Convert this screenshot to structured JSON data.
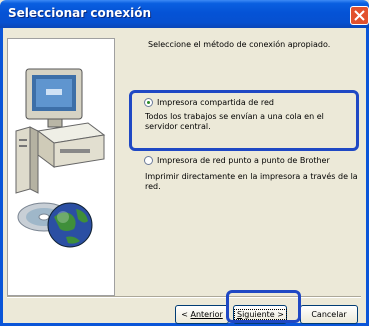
{
  "window": {
    "title": "Seleccionar conexión"
  },
  "main": {
    "instruction": "Seleccione el método de conexión apropiado.",
    "options": [
      {
        "label": "Impresora compartida de red",
        "description": "Todos los trabajos se envían a una cola en el servidor central.",
        "selected": true
      },
      {
        "label": "Impresora de red punto a punto de Brother",
        "description": "Imprimir directamente en la impresora a través de la red.",
        "selected": false
      }
    ]
  },
  "buttons": {
    "back_rest": "Anterior",
    "back_prefix": "< ",
    "next_mnemonic": "S",
    "next_rest": "iguiente >",
    "cancel": "Cancelar"
  },
  "icons": {
    "close": "close-icon",
    "illustration": "computer-cd-globe-illustration",
    "radio_on": "radio-selected-icon",
    "radio_off": "radio-unselected-icon"
  },
  "colors": {
    "titlebar": "#0553d6",
    "highlight": "#1f48c4",
    "dialog_bg": "#ece9d8"
  }
}
